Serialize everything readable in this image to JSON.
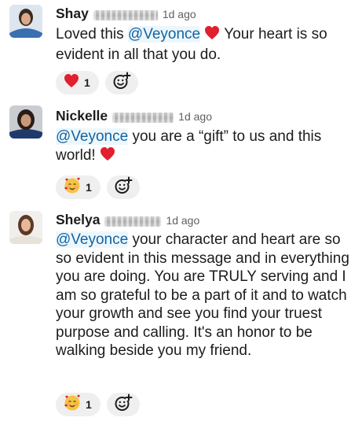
{
  "messages": [
    {
      "name": "Shay",
      "time": "1d ago",
      "body": [
        {
          "t": "text",
          "v": "Loved this "
        },
        {
          "t": "mention",
          "v": "@Veyonce"
        },
        {
          "t": "heart"
        },
        {
          "t": "text",
          "v": " Your heart is so evident in all that you do."
        }
      ],
      "reactions": [
        {
          "emoji": "red-heart",
          "count": "1"
        }
      ]
    },
    {
      "name": "Nickelle",
      "time": "1d ago",
      "body": [
        {
          "t": "mention",
          "v": "@Veyonce"
        },
        {
          "t": "text",
          "v": " you are a “gift” to us and this world! "
        },
        {
          "t": "heart"
        }
      ],
      "reactions": [
        {
          "emoji": "smiling-face-with-hearts",
          "count": "1"
        }
      ]
    },
    {
      "name": "Shelya",
      "time": "1d ago",
      "body": [
        {
          "t": "mention",
          "v": "@Veyonce"
        },
        {
          "t": "text",
          "v": " your character and heart are so so evident in this message and in everything you are doing. You are TRULY serving and I am so grateful to be a part of it and to watch your growth and see you find your truest purpose and calling.  It's an honor to be walking beside you my friend."
        }
      ],
      "reactions": [
        {
          "emoji": "smiling-face-with-hearts",
          "count": "1"
        }
      ]
    }
  ],
  "colors": {
    "mention": "#1264a3",
    "reaction_bg": "#efefef",
    "heart": "#e0202e"
  },
  "icons": {
    "add_reaction": "add-reaction-icon",
    "avatar": "user-photo"
  }
}
